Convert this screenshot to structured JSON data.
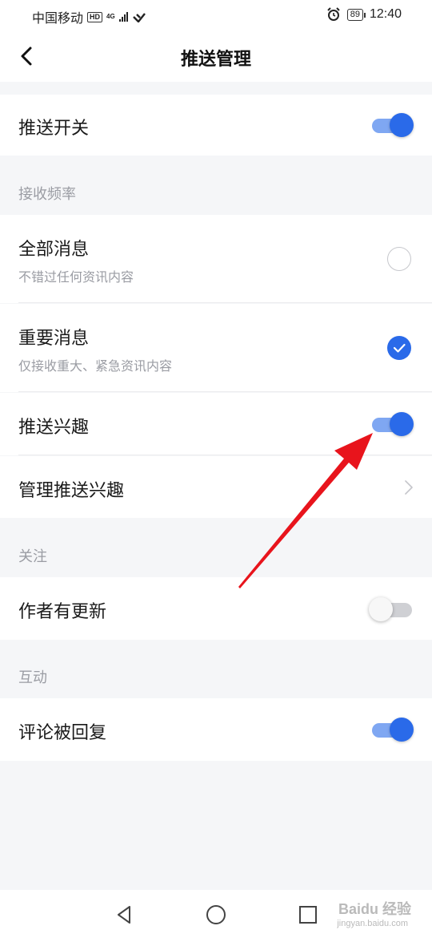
{
  "status_bar": {
    "carrier": "中国移动",
    "hd": "HD",
    "network": "4G",
    "battery": "89",
    "time": "12:40",
    "icons": [
      "signal-icon",
      "wifi-calling-icon",
      "alarm-icon",
      "battery-icon"
    ]
  },
  "header": {
    "title": "推送管理",
    "back_icon": "chevron-left-icon"
  },
  "rows": {
    "push_switch": {
      "label": "推送开关",
      "toggle_on": true
    },
    "all_messages": {
      "label": "全部消息",
      "sub": "不错过任何资讯内容",
      "selected": false
    },
    "important_messages": {
      "label": "重要消息",
      "sub": "仅接收重大、紧急资讯内容",
      "selected": true
    },
    "push_interest": {
      "label": "推送兴趣",
      "toggle_on": true
    },
    "manage_interest": {
      "label": "管理推送兴趣"
    },
    "author_update": {
      "label": "作者有更新",
      "toggle_on": false
    },
    "comment_reply": {
      "label": "评论被回复",
      "toggle_on": true
    }
  },
  "sections": {
    "frequency": "接收频率",
    "follow": "关注",
    "interaction": "互动"
  },
  "watermark": {
    "brand": "Baidu 经验",
    "url": "jingyan.baidu.com"
  },
  "colors": {
    "accent": "#2a6ae9",
    "accent_light": "#7fa7f2",
    "arrow": "#e8141c",
    "background": "#f5f6f8"
  }
}
